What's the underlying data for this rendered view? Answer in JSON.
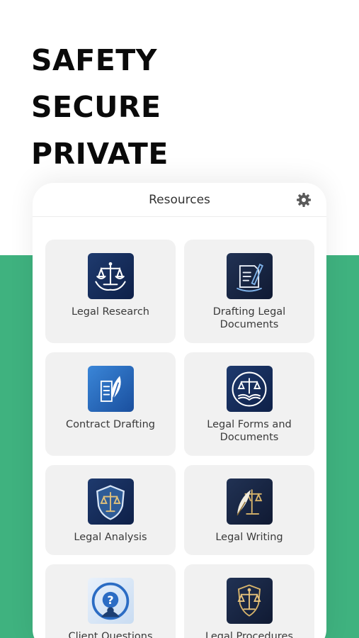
{
  "headline": [
    "SAFETY",
    "SECURE",
    "PRIVATE"
  ],
  "screen": {
    "title": "Resources",
    "settings_icon": "gear-icon"
  },
  "resources": [
    {
      "label": "Legal Research",
      "icon": "scales-laurel-icon"
    },
    {
      "label": "Drafting Legal Documents",
      "icon": "pen-document-icon"
    },
    {
      "label": "Contract Drafting",
      "icon": "leaf-document-icon"
    },
    {
      "label": "Legal Forms and Documents",
      "icon": "scales-book-icon"
    },
    {
      "label": "Legal Analysis",
      "icon": "shield-scales-icon"
    },
    {
      "label": "Legal Writing",
      "icon": "quill-scales-icon"
    },
    {
      "label": "Client Questions",
      "icon": "question-person-icon"
    },
    {
      "label": "Legal Procedures",
      "icon": "gold-scales-icon"
    }
  ],
  "colors": {
    "accent_green": "#3fb27f",
    "card_bg": "#f1f1f1",
    "icon_navy": "#1e3a6e"
  }
}
